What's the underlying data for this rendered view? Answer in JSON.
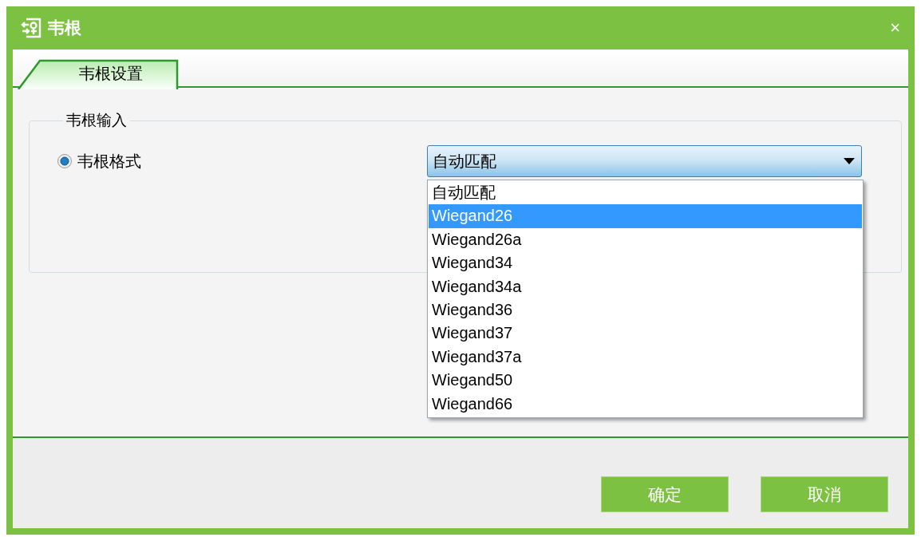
{
  "window": {
    "title": "韦根",
    "close": "×"
  },
  "tabs": [
    {
      "label": "韦根设置",
      "selected": true
    }
  ],
  "group": {
    "title": "韦根输入",
    "radio": {
      "label": "韦根格式",
      "selected": true
    },
    "combo": {
      "value": "自动匹配",
      "expanded": true,
      "options": [
        {
          "label": "自动匹配",
          "highlighted": false
        },
        {
          "label": "Wiegand26",
          "highlighted": true
        },
        {
          "label": "Wiegand26a",
          "highlighted": false
        },
        {
          "label": "Wiegand34",
          "highlighted": false
        },
        {
          "label": "Wiegand34a",
          "highlighted": false
        },
        {
          "label": "Wiegand36",
          "highlighted": false
        },
        {
          "label": "Wiegand37",
          "highlighted": false
        },
        {
          "label": "Wiegand37a",
          "highlighted": false
        },
        {
          "label": "Wiegand50",
          "highlighted": false
        },
        {
          "label": "Wiegand66",
          "highlighted": false
        }
      ]
    }
  },
  "buttons": [
    "确定",
    "取消"
  ]
}
